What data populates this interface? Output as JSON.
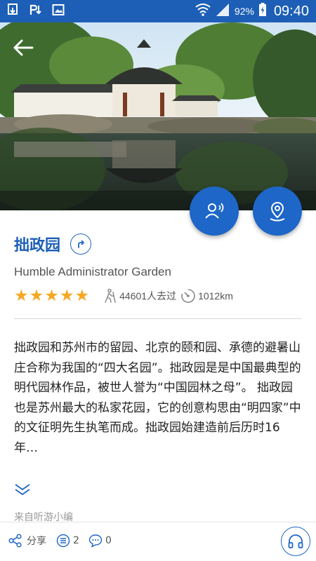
{
  "status_bar": {
    "battery": "92%",
    "time": "09:40",
    "icons": [
      "download-icon",
      "p-notification-icon",
      "image-icon",
      "wifi-icon",
      "signal-icon",
      "battery-icon"
    ]
  },
  "hero": {
    "description_icon": "garden-photo"
  },
  "attraction": {
    "name": "拙政园",
    "english_name": "Humble Administrator Garden",
    "rating": 5,
    "visitors": "44601人去过",
    "distance": "1012km",
    "description": "拙政园和苏州市的留园、北京的颐和园、承德的避暑山庄合称为我国的“四大名园”。拙政园是是中国最典型的明代园林作品，被世人誉为“中国园林之母”。 拙政园也是苏州最大的私家花园，它的创意构思由“明四家”中的文征明先生执笔而成。拙政园始建造前后历时16年…",
    "source": "来自听游小编"
  },
  "bottom_bar": {
    "share_label": "分享",
    "list_count": "2",
    "comment_count": "0"
  },
  "colors": {
    "primary": "#1e66c7",
    "status_bar": "#1d5fb6",
    "star": "#f7a823"
  }
}
